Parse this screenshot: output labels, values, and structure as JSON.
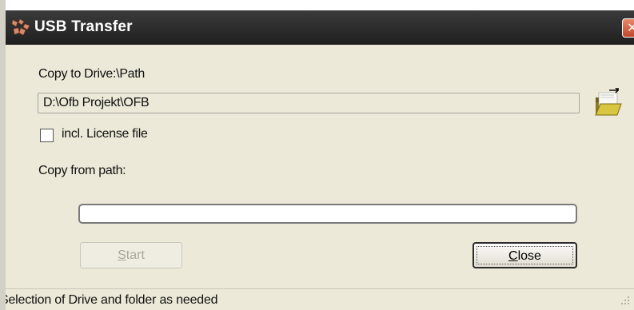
{
  "window": {
    "title": "USB Transfer"
  },
  "form": {
    "copy_to_label": "Copy to Drive:\\Path",
    "path_value": "D:\\Ofb Projekt\\OFB",
    "license_checkbox_label": "incl. License file",
    "license_checked": false,
    "copy_from_label": "Copy from path:",
    "copy_from_value": "",
    "progress": 0
  },
  "buttons": {
    "start": {
      "prefix": "",
      "accel": "S",
      "rest": "tart",
      "enabled": false
    },
    "close": {
      "prefix": "",
      "accel": "C",
      "rest": "lose",
      "enabled": true
    }
  },
  "status": {
    "text": "Selection of Drive and folder as needed"
  },
  "icons": {
    "app": "usb-app-icon",
    "close": "close-icon",
    "browse": "open-folder-icon",
    "grip": "resize-grip-icon"
  },
  "colors": {
    "titlebar": "#2a2a2a",
    "dialog_bg": "#ece9d8",
    "close_button": "#c9522f",
    "folder": "#c9b733"
  }
}
